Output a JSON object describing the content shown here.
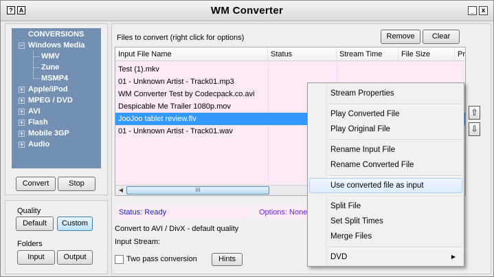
{
  "window": {
    "title": "WM Converter",
    "help_icon": "?",
    "about_icon": "A",
    "minimize_label": "_",
    "close_label": "x"
  },
  "tree": {
    "root_label": "CONVERSIONS",
    "categories": [
      {
        "label": "Windows Media",
        "expander": "−"
      },
      {
        "label": "Apple/iPod",
        "expander": "+"
      },
      {
        "label": "MPEG / DVD",
        "expander": "+"
      },
      {
        "label": "AVI",
        "expander": "+"
      },
      {
        "label": "Flash",
        "expander": "+"
      },
      {
        "label": "Mobile 3GP",
        "expander": "+"
      },
      {
        "label": "Audio",
        "expander": "+"
      }
    ],
    "windows_media_children": [
      "WMV",
      "Zune",
      "MSMP4"
    ]
  },
  "left_buttons": {
    "convert": "Convert",
    "stop": "Stop"
  },
  "quality": {
    "label": "Quality",
    "default": "Default",
    "custom": "Custom"
  },
  "folders": {
    "label": "Folders",
    "input": "Input",
    "output": "Output"
  },
  "files": {
    "heading": "Files to convert (right click for options)",
    "remove": "Remove",
    "clear": "Clear",
    "columns": [
      "Input File Name",
      "Status",
      "Stream Time",
      "File Size",
      "Pr"
    ],
    "rows": [
      "Test (1).mkv",
      "01 - Unknown Artist - Track01.mp3",
      "WM Converter Test by Codecpack.co.avi",
      "Despicable Me Trailer 1080p.mov",
      "JooJoo tablet review.flv",
      "01 - Unknown Artist - Track01.wav"
    ],
    "selected_index": 4,
    "scroll_left": "◀",
    "scroll_grip": "III"
  },
  "status": {
    "text": "Status: Ready",
    "options": "Options: None"
  },
  "info": {
    "convert_to": "Convert to AVI / DivX - default quality",
    "input_stream": "Input Stream:",
    "two_pass_label": "Two pass conversion",
    "hints": "Hints"
  },
  "move_up": "⇧",
  "move_down": "⇩",
  "context_menu": {
    "items": [
      "Stream Properties",
      "Play Converted File",
      "Play Original File",
      "Rename Input File",
      "Rename Converted File",
      "Use converted file as input",
      "Split File",
      "Set Split Times",
      "Merge Files",
      "DVD"
    ],
    "highlighted": "Use converted file as input",
    "submenu_arrow": "▶"
  },
  "colors": {
    "tree_bg": "#7390b3",
    "list_bg": "#fbe9f6",
    "selection": "#3399ff",
    "status_text": "#2222cc",
    "options_text": "#6b28c8"
  }
}
